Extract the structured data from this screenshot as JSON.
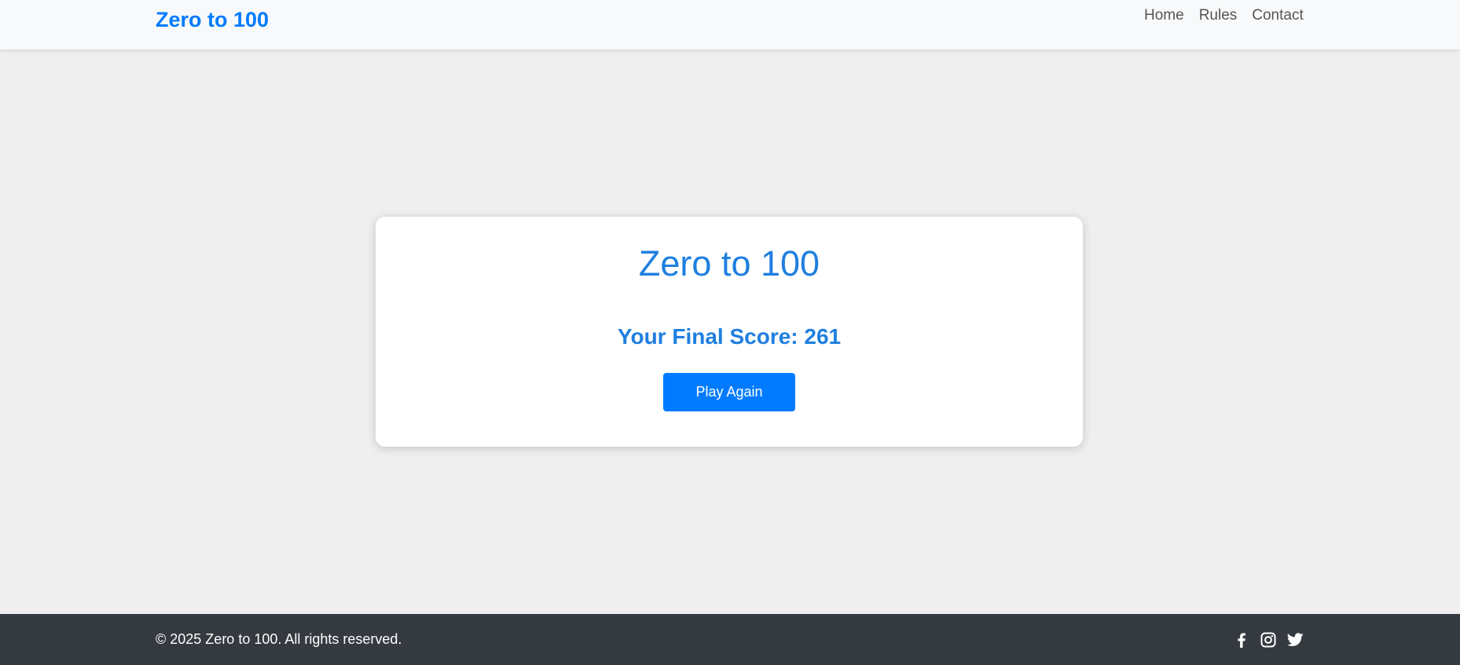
{
  "navbar": {
    "brand": "Zero to 100",
    "links": [
      "Home",
      "Rules",
      "Contact"
    ]
  },
  "card": {
    "title": "Zero to 100",
    "final_score_text": "Your Final Score: 261",
    "play_again_label": "Play Again"
  },
  "footer": {
    "copyright": "© 2025 Zero to 100. All rights reserved.",
    "social_icons": [
      "facebook-icon",
      "instagram-icon",
      "twitter-icon"
    ]
  },
  "colors": {
    "accent": "#007bff",
    "navbar_bg": "#f8f9fa",
    "page_bg": "#efefef",
    "footer_bg": "#343a40"
  }
}
